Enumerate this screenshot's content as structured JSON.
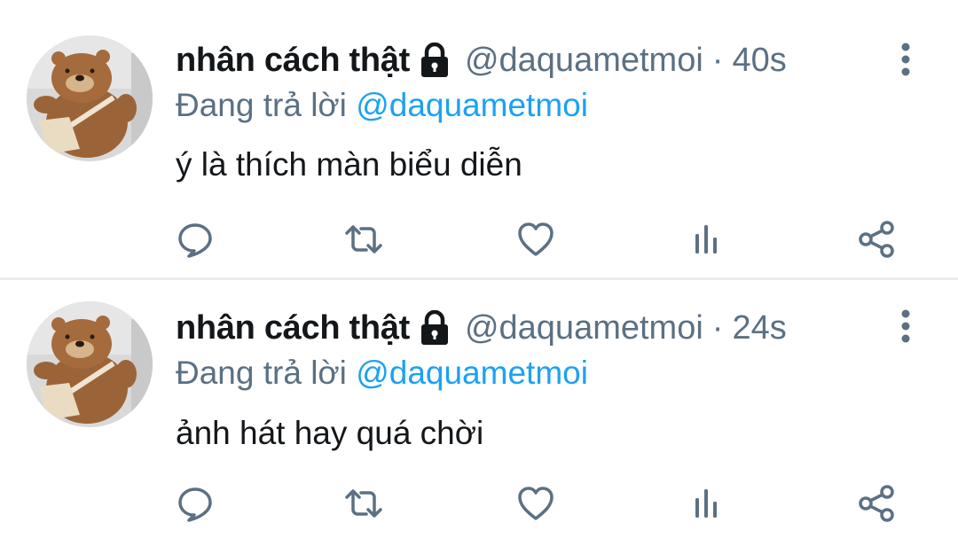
{
  "colors": {
    "name": "#14171a",
    "secondary": "#5b7083",
    "mention": "#1da1f2",
    "divider": "#e9ecef",
    "icon": "#5b7083"
  },
  "tweets": [
    {
      "author_name": "nhân cách thật",
      "handle": "@daquametmoi",
      "separator": "·",
      "time": "40s",
      "reply_prefix": "Đang trả lời",
      "reply_mention": "@daquametmoi",
      "text": "ý là thích màn biểu diễn",
      "icons": [
        "lock-icon",
        "more-icon",
        "reply-icon",
        "retweet-icon",
        "like-icon",
        "stats-icon",
        "share-icon"
      ]
    },
    {
      "author_name": "nhân cách thật",
      "handle": "@daquametmoi",
      "separator": "·",
      "time": "24s",
      "reply_prefix": "Đang trả lời",
      "reply_mention": "@daquametmoi",
      "text": "ảnh hát hay quá chời",
      "icons": [
        "lock-icon",
        "more-icon",
        "reply-icon",
        "retweet-icon",
        "like-icon",
        "stats-icon",
        "share-icon"
      ]
    }
  ]
}
